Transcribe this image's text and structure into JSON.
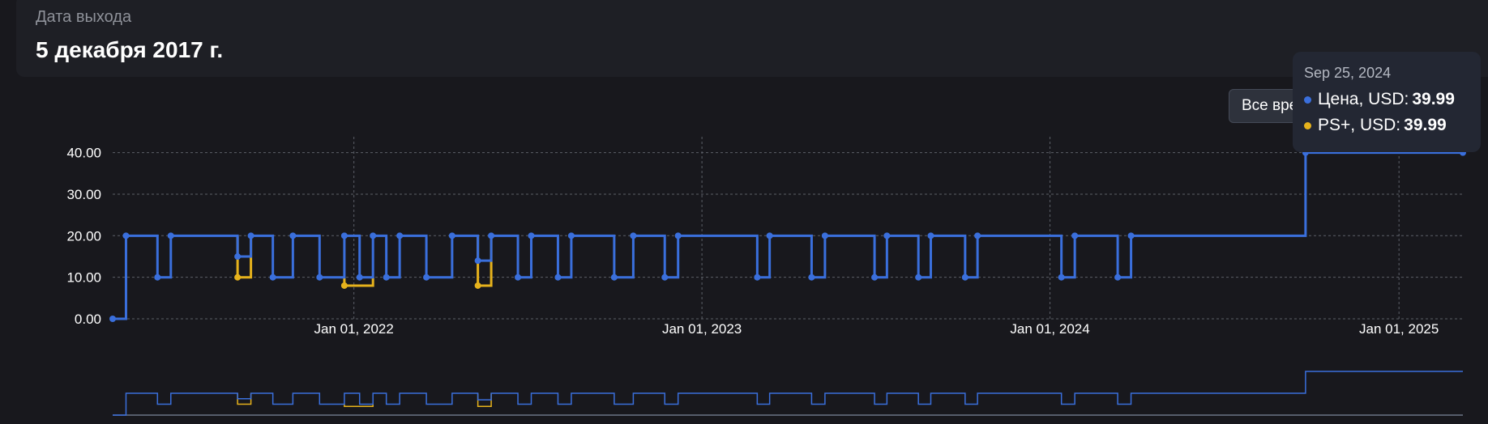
{
  "release": {
    "label": "Дата выхода",
    "value": "5 декабря 2017 г."
  },
  "range_button": {
    "label": "Все время"
  },
  "tooltip": {
    "date": "Sep 25, 2024",
    "rows": [
      {
        "label": "Цена, USD",
        "value": "39.99",
        "color": "#3a6fdc"
      },
      {
        "label": "PS+, USD",
        "value": "39.99",
        "color": "#e6b21c"
      }
    ]
  },
  "chart_data": {
    "type": "line",
    "step": "after",
    "title": "",
    "xlabel": "",
    "ylabel": "",
    "x_range": [
      "2021-04-23",
      "2025-03-09"
    ],
    "ylim": [
      0,
      40
    ],
    "y_ticks": [
      "0.00",
      "10.00",
      "20.00",
      "30.00",
      "40.00"
    ],
    "x_ticks": [
      {
        "date": "2022-01-01",
        "label": "Jan 01, 2022"
      },
      {
        "date": "2023-01-01",
        "label": "Jan 01, 2023"
      },
      {
        "date": "2024-01-01",
        "label": "Jan 01, 2024"
      },
      {
        "date": "2025-01-01",
        "label": "Jan 01, 2025"
      }
    ],
    "grid": true,
    "legend": "none",
    "navigator": true,
    "series": [
      {
        "name": "Цена, USD",
        "color": "#3a6fdc",
        "points": [
          [
            "2021-04-23",
            0
          ],
          [
            "2021-05-07",
            19.99
          ],
          [
            "2021-06-09",
            9.99
          ],
          [
            "2021-06-23",
            19.99
          ],
          [
            "2021-09-01",
            14.99
          ],
          [
            "2021-09-15",
            19.99
          ],
          [
            "2021-10-08",
            9.99
          ],
          [
            "2021-10-29",
            19.99
          ],
          [
            "2021-11-26",
            9.99
          ],
          [
            "2021-12-22",
            19.99
          ],
          [
            "2022-01-07",
            9.99
          ],
          [
            "2022-01-21",
            19.99
          ],
          [
            "2022-02-04",
            9.99
          ],
          [
            "2022-02-18",
            19.99
          ],
          [
            "2022-03-18",
            9.99
          ],
          [
            "2022-04-14",
            19.99
          ],
          [
            "2022-05-11",
            13.99
          ],
          [
            "2022-05-25",
            19.99
          ],
          [
            "2022-06-22",
            9.99
          ],
          [
            "2022-07-06",
            19.99
          ],
          [
            "2022-08-03",
            9.99
          ],
          [
            "2022-08-17",
            19.99
          ],
          [
            "2022-10-01",
            9.99
          ],
          [
            "2022-10-21",
            19.99
          ],
          [
            "2022-11-23",
            9.99
          ],
          [
            "2022-12-07",
            19.99
          ],
          [
            "2023-02-28",
            9.99
          ],
          [
            "2023-03-13",
            19.99
          ],
          [
            "2023-04-26",
            9.99
          ],
          [
            "2023-05-10",
            19.99
          ],
          [
            "2023-07-01",
            9.99
          ],
          [
            "2023-07-14",
            19.99
          ],
          [
            "2023-08-16",
            9.99
          ],
          [
            "2023-08-29",
            19.99
          ],
          [
            "2023-10-04",
            9.99
          ],
          [
            "2023-10-17",
            19.99
          ],
          [
            "2024-01-13",
            9.99
          ],
          [
            "2024-01-27",
            19.99
          ],
          [
            "2024-03-12",
            9.99
          ],
          [
            "2024-03-26",
            19.99
          ],
          [
            "2024-09-25",
            39.99
          ],
          [
            "2025-03-09",
            39.99
          ]
        ]
      },
      {
        "name": "PS+, USD",
        "color": "#e6b21c",
        "segments": [
          [
            [
              "2021-09-01",
              9.99
            ],
            [
              "2021-09-15",
              9.99
            ]
          ],
          [
            [
              "2021-12-22",
              7.99
            ],
            [
              "2022-01-21",
              7.99
            ]
          ],
          [
            [
              "2022-05-11",
              7.99
            ],
            [
              "2022-05-25",
              7.99
            ]
          ]
        ]
      }
    ]
  }
}
